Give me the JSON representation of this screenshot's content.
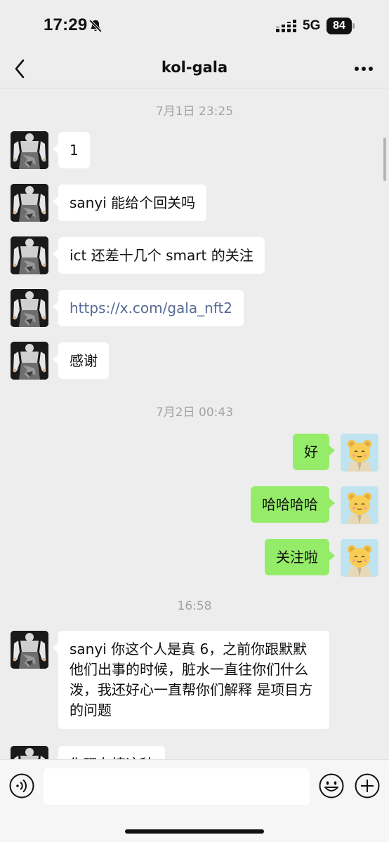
{
  "status_bar": {
    "time": "17:29",
    "network": "5G",
    "battery": "84"
  },
  "nav": {
    "title": "kol-gala"
  },
  "messages": {
    "ts1": "7月1日 23:25",
    "m1": "1",
    "m2": "sanyi  能给个回关吗",
    "m3": "ict 还差十几个 smart 的关注",
    "m4": "https://x.com/gala_nft2",
    "m5": "感谢",
    "ts2": "7月2日 00:43",
    "m6": "好",
    "m7": "哈哈哈哈",
    "m8": "关注啦",
    "ts3": "16:58",
    "m9": "sanyi 你这个人是真 6，之前你跟默默他们出事的时候，脏水一直往你们什么泼，我还好心一直帮你们解释 是项目方的问题",
    "m10": "你现在搞这种"
  },
  "input": {
    "value": ""
  },
  "colors": {
    "background": "#ededed",
    "incoming_bubble": "#ffffff",
    "outgoing_bubble": "#95ec69",
    "link": "#576b95"
  },
  "icons": [
    "bell-slash-icon",
    "signal-icon",
    "battery-icon",
    "back-icon",
    "more-icon",
    "voice-icon",
    "emoji-icon",
    "plus-icon"
  ]
}
